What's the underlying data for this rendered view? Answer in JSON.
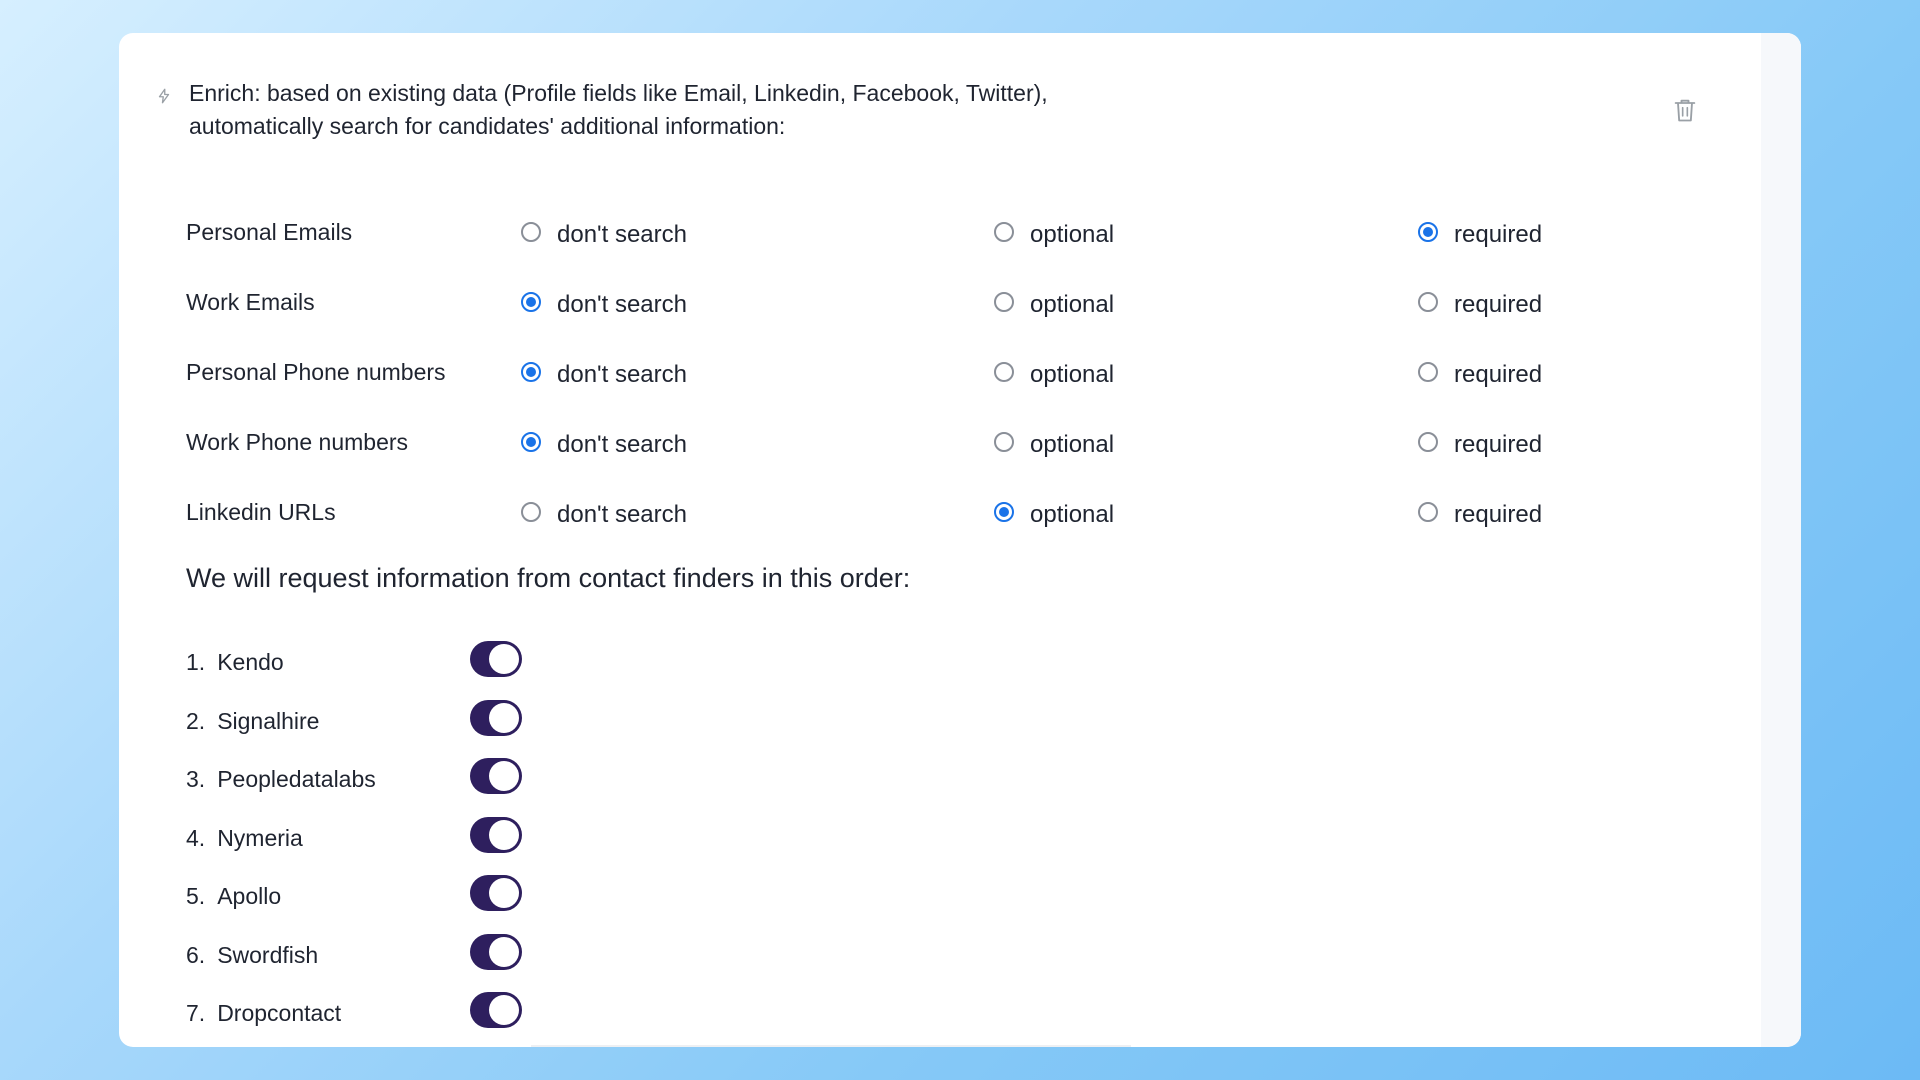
{
  "enrich": {
    "intro_line1": "Enrich: based on existing data (Profile fields like Email, Linkedin, Facebook, Twitter),",
    "intro_line2": "automatically search for candidates' additional information:"
  },
  "option_labels": [
    "don't search",
    "optional",
    "required"
  ],
  "fields": [
    {
      "label": "Personal Emails",
      "selected": 2
    },
    {
      "label": "Work Emails",
      "selected": 0
    },
    {
      "label": "Personal Phone numbers",
      "selected": 0
    },
    {
      "label": "Work Phone numbers",
      "selected": 0
    },
    {
      "label": "Linkedin URLs",
      "selected": 1
    }
  ],
  "order_title": "We will request information from contact finders in this order:",
  "finders": [
    {
      "num": "1.",
      "name": "Kendo",
      "enabled": true
    },
    {
      "num": "2.",
      "name": "Signalhire",
      "enabled": true
    },
    {
      "num": "3.",
      "name": "Peopledatalabs",
      "enabled": true
    },
    {
      "num": "4.",
      "name": "Nymeria",
      "enabled": true
    },
    {
      "num": "5.",
      "name": "Apollo",
      "enabled": true
    },
    {
      "num": "6.",
      "name": "Swordfish",
      "enabled": true
    },
    {
      "num": "7.",
      "name": "Dropcontact",
      "enabled": true
    }
  ],
  "colors": {
    "radio_checked": "#1a73e8",
    "toggle_on": "#2e1f5e"
  },
  "icons": {
    "bolt": "bolt-icon",
    "trash": "trash-icon"
  }
}
